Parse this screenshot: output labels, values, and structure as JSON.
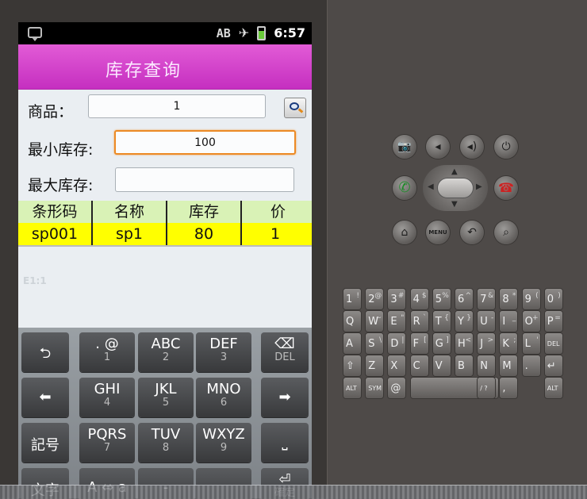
{
  "status": {
    "ab": "AB",
    "clock": "6:57"
  },
  "app": {
    "title": "库存查询"
  },
  "form": {
    "product_label": "商品：",
    "product_value": "1",
    "min_label": "最小库存:",
    "min_value": "100",
    "max_label": "最大库存:",
    "max_value": ""
  },
  "table": {
    "headers": [
      "条形码",
      "名称",
      "库存",
      "价"
    ],
    "rows": [
      [
        "sp001",
        "sp1",
        "80",
        "1"
      ]
    ]
  },
  "ghost": "E1:1",
  "keyboard": {
    "rows": [
      [
        {
          "main": "⮌",
          "sub": ""
        },
        {
          "main": ". @",
          "sub": "1"
        },
        {
          "main": "ABC",
          "sub": "2"
        },
        {
          "main": "DEF",
          "sub": "3"
        },
        {
          "main": "⌫",
          "sub": "DEL"
        }
      ],
      [
        {
          "main": "⬅",
          "sub": ""
        },
        {
          "main": "GHI",
          "sub": "4"
        },
        {
          "main": "JKL",
          "sub": "5"
        },
        {
          "main": "MNO",
          "sub": "6"
        },
        {
          "main": "➡",
          "sub": ""
        }
      ],
      [
        {
          "main": "記号",
          "sub": ""
        },
        {
          "main": "PQRS",
          "sub": "7"
        },
        {
          "main": "TUV",
          "sub": "8"
        },
        {
          "main": "WXYZ",
          "sub": "9"
        },
        {
          "main": "⎵",
          "sub": ""
        }
      ],
      [
        {
          "main": "文字",
          "sub": ""
        },
        {
          "main": "A ⇔ a",
          "sub": ""
        },
        {
          "main": "-",
          "sub": ""
        },
        {
          "main": "",
          "sub": ""
        },
        {
          "main": "⏎",
          "sub": "確定"
        }
      ]
    ]
  },
  "emulator": {
    "buttons": [
      {
        "name": "camera-icon",
        "glyph": "📷"
      },
      {
        "name": "volume-down-icon",
        "glyph": "◂"
      },
      {
        "name": "volume-up-icon",
        "glyph": "◂)"
      },
      {
        "name": "power-icon",
        "glyph": "⏻"
      },
      {
        "name": "call-icon",
        "glyph": "✆"
      },
      {
        "name": "end-call-icon",
        "glyph": "☎"
      },
      {
        "name": "home-icon",
        "glyph": "⌂"
      },
      {
        "name": "menu-icon",
        "glyph": "MENU"
      },
      {
        "name": "back-icon",
        "glyph": "↶"
      },
      {
        "name": "search-icon",
        "glyph": "⌕"
      }
    ],
    "keys": [
      [
        "1",
        "2",
        "3",
        "4",
        "5",
        "6",
        "7",
        "8",
        "9",
        "0"
      ],
      [
        "Q",
        "W",
        "E",
        "R",
        "T",
        "Y",
        "U",
        "I",
        "O",
        "P"
      ],
      [
        "A",
        "S",
        "D",
        "F",
        "G",
        "H",
        "J",
        "K",
        "L",
        "DEL"
      ],
      [
        "⇧",
        "Z",
        "X",
        "C",
        "V",
        "B",
        "N",
        "M",
        ".",
        "↵"
      ],
      [
        "ALT",
        "SYM",
        "@",
        "",
        "",
        "",
        "/ ?",
        ",",
        "",
        "ALT"
      ]
    ],
    "alt_keys": [
      [
        "!",
        "@",
        "#",
        "$",
        "%",
        "^",
        "&",
        "*",
        "(",
        ")"
      ],
      [
        "",
        "~",
        "\"",
        "`",
        "{",
        "}",
        "-",
        "_",
        "+",
        "="
      ],
      [
        "",
        "\\",
        "|",
        "[",
        "]",
        "<",
        ">",
        ";",
        "'",
        ""
      ]
    ]
  },
  "colors": {
    "title_bar": "#d04bcf",
    "header_row": "#d9f2b6",
    "data_row": "#ffff00",
    "focus": "#ec8a25"
  }
}
